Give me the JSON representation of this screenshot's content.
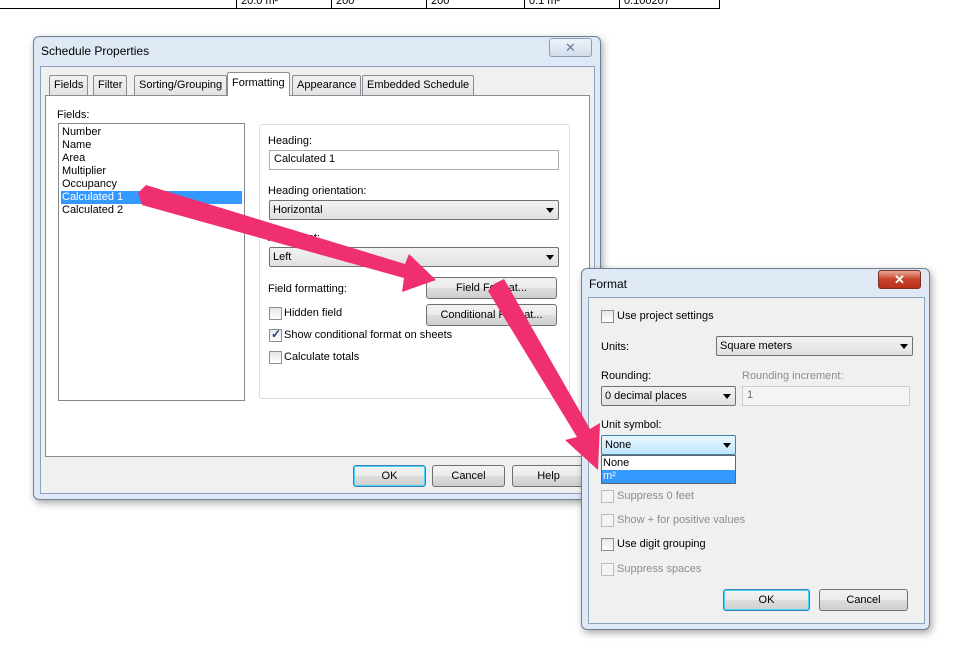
{
  "background_table": {
    "cells": [
      "20.0 m²",
      "200",
      "200",
      "0.1 m²",
      "0.100207"
    ]
  },
  "schedule_properties": {
    "title": "Schedule Properties",
    "close_label": "✕",
    "tabs": [
      "Fields",
      "Filter",
      "Sorting/Grouping",
      "Formatting",
      "Appearance",
      "Embedded Schedule"
    ],
    "active_tab": "Formatting",
    "fields_label": "Fields:",
    "fields": [
      "Number",
      "Name",
      "Area",
      "Multiplier",
      "Occupancy",
      "Calculated 1",
      "Calculated 2"
    ],
    "selected_field": "Calculated 1",
    "heading_label": "Heading:",
    "heading_value": "Calculated 1",
    "heading_orientation_label": "Heading orientation:",
    "heading_orientation_value": "Horizontal",
    "alignment_label": "Alignment:",
    "alignment_value": "Left",
    "field_formatting_label": "Field formatting:",
    "field_format_button": "Field Format...",
    "conditional_format_button": "Conditional Format...",
    "hidden_field_label": "Hidden field",
    "hidden_field_checked": false,
    "show_conditional_label": "Show conditional format on sheets",
    "show_conditional_checked": true,
    "calculate_totals_label": "Calculate totals",
    "calculate_totals_checked": false,
    "ok_label": "OK",
    "cancel_label": "Cancel",
    "help_label": "Help"
  },
  "format_dialog": {
    "title": "Format",
    "close_label": "✕",
    "use_project_settings_label": "Use project settings",
    "use_project_settings_checked": false,
    "units_label": "Units:",
    "units_value": "Square meters",
    "rounding_label": "Rounding:",
    "rounding_value": "0 decimal places",
    "rounding_increment_label": "Rounding increment:",
    "rounding_increment_value": "1",
    "unit_symbol_label": "Unit symbol:",
    "unit_symbol_value": "None",
    "unit_symbol_options": [
      "None",
      "m²"
    ],
    "unit_symbol_highlighted": "m²",
    "suppress_zero_feet_label": "Suppress 0 feet",
    "show_plus_label": "Show + for positive values",
    "use_digit_grouping_label": "Use digit grouping",
    "suppress_spaces_label": "Suppress spaces",
    "ok_label": "OK",
    "cancel_label": "Cancel"
  },
  "annotation": {
    "arrow_color": "#f0306e"
  }
}
